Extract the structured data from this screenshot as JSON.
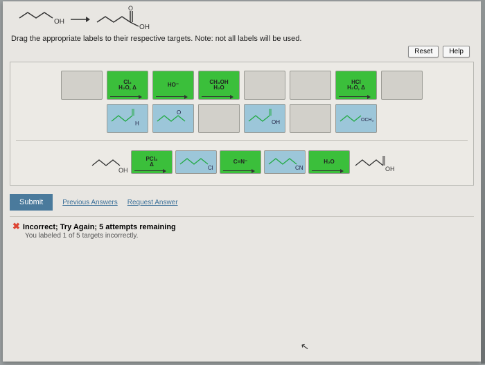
{
  "header": {
    "reactant_label": "OH",
    "product_top": "O",
    "product_label": "OH"
  },
  "instruction": "Drag the appropriate labels to their respective targets. Note: not all labels will be used.",
  "buttons": {
    "reset": "Reset",
    "help": "Help",
    "submit": "Submit"
  },
  "links": {
    "prev": "Previous Answers",
    "request": "Request Answer"
  },
  "feedback": {
    "title": "Incorrect; Try Again; 5 attempts remaining",
    "sub": "You labeled 1 of 5 targets incorrectly."
  },
  "row1": {
    "t2": {
      "l1": "Cl₂",
      "l2": "H₂O, Δ"
    },
    "t3": "HO⁻",
    "t4": {
      "l1": "CH₃OH",
      "l2": "H₂O"
    },
    "t7": {
      "l1": "HCl",
      "l2": "H₂O, Δ"
    }
  },
  "row2": {
    "t1": "H",
    "t2": "O",
    "t4": "OH",
    "t6": "OCH₃"
  },
  "row3": {
    "start": "OH",
    "pcl": {
      "l1": "PCl₃",
      "l2": "Δ"
    },
    "cl": "Cl",
    "cn_eq": "C≡N⁻",
    "cn": "CN",
    "h2o": "H₂O",
    "end": "OH"
  }
}
